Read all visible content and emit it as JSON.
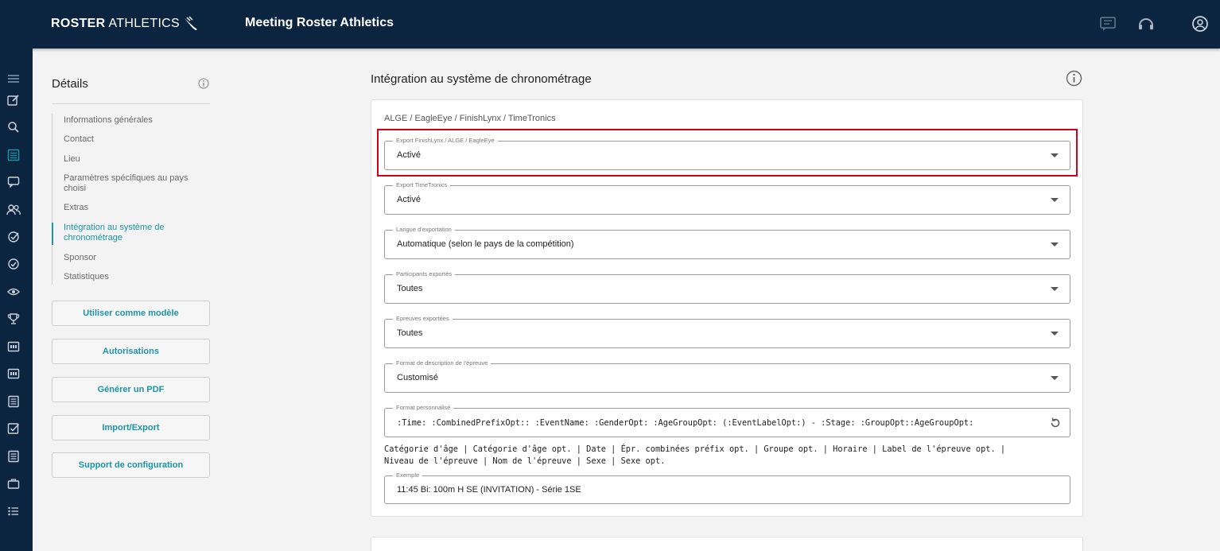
{
  "header": {
    "brand_bold": "ROSTER",
    "brand_light": "ATHLETICS",
    "meeting_title": "Meeting Roster Athletics",
    "icons": [
      "chat-icon",
      "headset-icon",
      "account-icon"
    ]
  },
  "rail": {
    "icons": [
      "menu-icon",
      "edit-icon",
      "search-icon",
      "list-icon",
      "message-icon",
      "people-icon",
      "check-circle-icon",
      "check-circle-icon",
      "eye-icon",
      "trophy-icon",
      "scoreboard-icon",
      "scoreboard-icon",
      "document-icon",
      "checkbox-icon",
      "document-icon",
      "briefcase-icon",
      "list-bullets-icon"
    ],
    "active_index": 3
  },
  "details": {
    "title": "Détails",
    "nav": [
      "Informations générales",
      "Contact",
      "Lieu",
      "Paramètres spécifiques au pays choisi",
      "Extras",
      "Intégration au système de chronométrage",
      "Sponsor",
      "Statistiques"
    ],
    "active_nav_index": 5,
    "buttons": [
      "Utiliser comme modèle",
      "Autorisations",
      "Générer un PDF",
      "Import/Export",
      "Support de configuration"
    ]
  },
  "main": {
    "title": "Intégration au système de chronométrage",
    "subtitle": "ALGE / EagleEye / FinishLynx / TimeTronics",
    "fields": [
      {
        "label": "Export FinishLynx / ALGE / EagleEye",
        "value": "Activé",
        "type": "select"
      },
      {
        "label": "Export TimeTronics",
        "value": "Activé",
        "type": "select"
      },
      {
        "label": "Langue d'exportation",
        "value": "Automatique (selon le pays de la compétition)",
        "type": "select"
      },
      {
        "label": "Participants exportés",
        "value": "Toutes",
        "type": "select"
      },
      {
        "label": "Epreuves exportées",
        "value": "Toutes",
        "type": "select"
      },
      {
        "label": "Format de description de l'épreuve",
        "value": "Customisé",
        "type": "select"
      }
    ],
    "custom_format": {
      "label": "Format personnalisé",
      "value": ":Time: :CombinedPrefixOpt:: :EventName: :GenderOpt: :AgeGroupOpt: (:EventLabelOpt:) - :Stage: :GroupOpt::AgeGroupOpt:"
    },
    "tokens": "Catégorie d'âge | Catégorie d'âge opt. | Date | Épr. combinées préfix opt. | Groupe opt. | Horaire | Label de l'épreuve opt. | Niveau de l'épreuve | Nom de l'épreuve | Sexe | Sexe opt.",
    "example": {
      "label": "Exemple",
      "value": "11:45 Bi: 100m H SE (INVITATION) - Série 1SE"
    }
  },
  "colors": {
    "header_bg": "#0b2540",
    "accent": "#1a94a6",
    "highlight": "#d0021b"
  }
}
